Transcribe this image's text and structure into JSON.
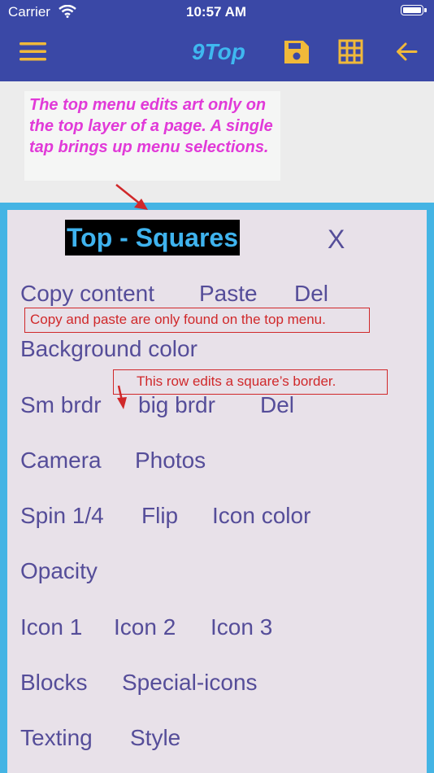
{
  "status_bar": {
    "carrier": "Carrier",
    "time": "10:57 AM"
  },
  "nav": {
    "title": "9Top",
    "icons": [
      "hamburger-menu-icon",
      "save-icon",
      "grid-icon",
      "back-arrow-icon"
    ]
  },
  "note": "The top menu edits art only on the top layer of a page. A single tap brings up menu selections.",
  "panel": {
    "title": "Top - Squares",
    "close": "X",
    "rows": [
      [
        "Copy content",
        "Paste",
        "Del"
      ],
      [
        "Background color"
      ],
      [
        "Sm brdr",
        "big brdr",
        "Del"
      ],
      [
        "Camera",
        "Photos"
      ],
      [
        "Spin 1/4",
        "Flip",
        "Icon color"
      ],
      [
        "Opacity"
      ],
      [
        "Icon 1",
        "Icon 2",
        "Icon 3"
      ],
      [
        "Blocks",
        "Special-icons"
      ],
      [
        "Texting",
        "Style"
      ]
    ]
  },
  "callouts": {
    "copy_paste": "Copy and paste are only found on the top menu.",
    "border_row": "This row edits a square’s border."
  },
  "colors": {
    "nav_bar": "#3a48a6",
    "nav_icons": "#f0b93a",
    "title": "#3fb8f0",
    "note_text": "#e13ad8",
    "panel_border": "#44b4e4",
    "menu_text": "#554d99",
    "callout": "#d0282a"
  }
}
